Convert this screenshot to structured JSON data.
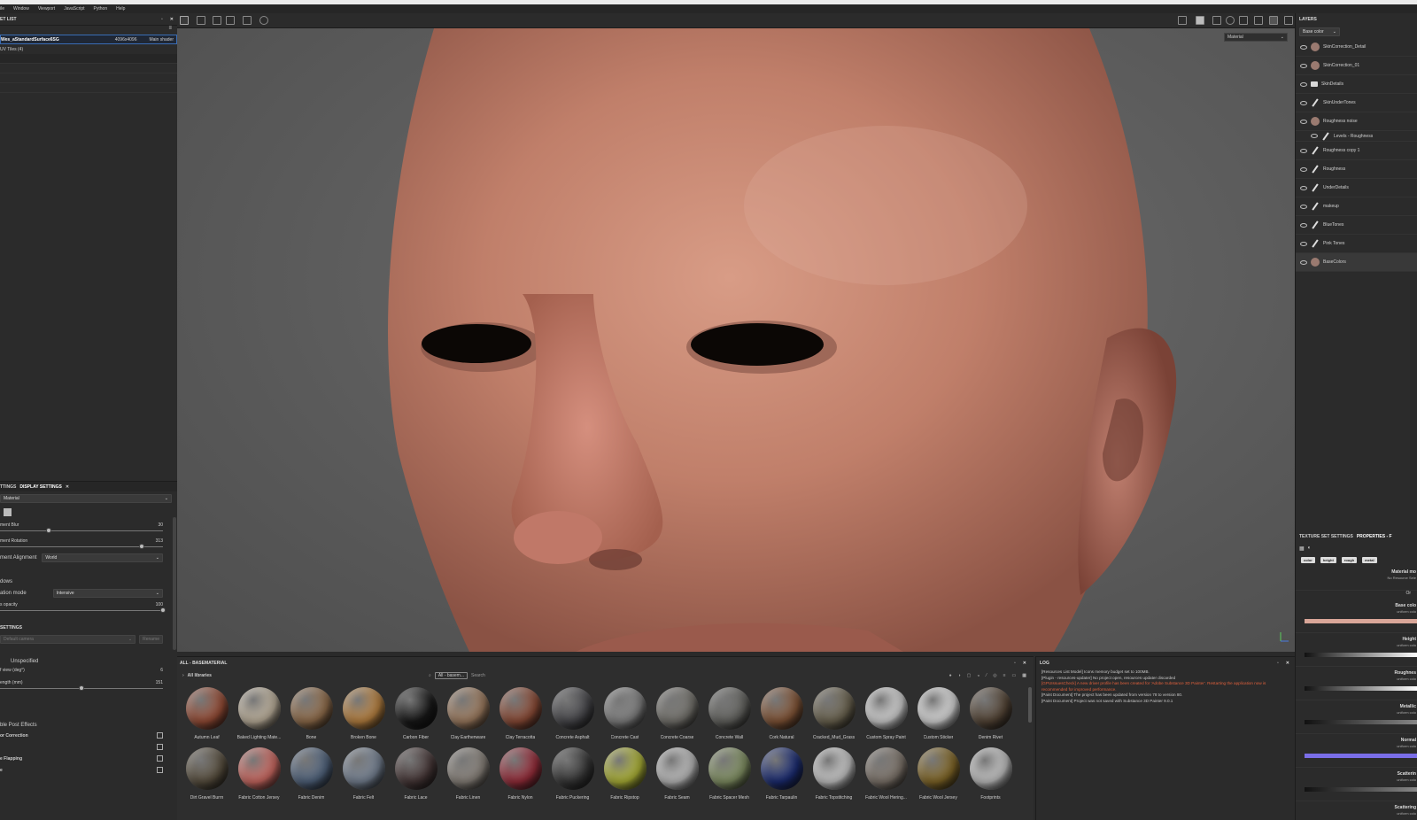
{
  "menubar": {
    "items": [
      "ile",
      "Window",
      "Viewport",
      "JavaScript",
      "Python",
      "Help"
    ]
  },
  "textureset_list": {
    "title": "ET LIST",
    "row": {
      "name": "Wes_aStandardSurface6SG",
      "size": "4096x4096",
      "shader": "Main shader"
    },
    "uv_tiles": "UV Tiles (4)"
  },
  "display_settings": {
    "tabs": [
      "TTINGS",
      "DISPLAY SETTINGS"
    ],
    "env_dropdown": "Material",
    "sliders": [
      {
        "label": "ment Blur",
        "value": "30",
        "fraction": 0.3
      },
      {
        "label": "ment Rotation",
        "value": "313",
        "fraction": 0.87
      }
    ],
    "alignment_label": "ment Alignment",
    "alignment_value": "World",
    "shadows_label": "dows",
    "mode_label": "ation mode",
    "mode_value": "Intensive",
    "opacity_label": "s opacity",
    "opacity_value": "100",
    "opacity_fraction": 1.0,
    "camera_section": "SETTINGS",
    "camera_dd": "Default camera",
    "camera_btn": "Rename",
    "unspecified": "Unspecified",
    "fov_label": "f view (deg°)",
    "fov_value": "6",
    "focal_label": "ength (mm)",
    "focal_value": "151",
    "focal_fraction": 0.5,
    "post_effects": "ble Post Effects",
    "checks": [
      "or Correction",
      "",
      "e Flapping",
      "e"
    ]
  },
  "viewport": {
    "dropdown": "Material"
  },
  "layers": {
    "title": "LAYERS",
    "channel_dropdown": "Base color",
    "items": [
      {
        "name": "SkinCorrection_Detail",
        "kind": "sphere"
      },
      {
        "name": "SkinCorrection_01",
        "kind": "sphere"
      },
      {
        "name": "SkinDetails",
        "kind": "folder"
      },
      {
        "name": "SkinUnderTones",
        "kind": "brush"
      },
      {
        "name": "Roughness noise",
        "kind": "sphere"
      },
      {
        "name": "Levels - Roughness",
        "kind": "sub"
      },
      {
        "name": "Roughness copy 1",
        "kind": "brush"
      },
      {
        "name": "Roughness",
        "kind": "brush"
      },
      {
        "name": "UnderDetails",
        "kind": "brush"
      },
      {
        "name": "makeup",
        "kind": "brush"
      },
      {
        "name": "BlueTones",
        "kind": "brush"
      },
      {
        "name": "Pink Tones",
        "kind": "brush"
      },
      {
        "name": "BaseColors",
        "kind": "sphere-sel"
      }
    ]
  },
  "texture_set_settings": {
    "tabs": [
      "TEXTURE SET SETTINGS",
      "PROPERTIES - F"
    ],
    "chips": [
      "color",
      "height",
      "rough",
      "metal"
    ],
    "material_title": "Material mo",
    "material_sub": "No Resource Sele",
    "or": "Or",
    "props": [
      {
        "title": "Base colo",
        "sub": "uniform colo"
      },
      {
        "title": "Height",
        "sub": "uniform colo"
      },
      {
        "title": "Roughnes",
        "sub": "uniform colo"
      },
      {
        "title": "Metallic",
        "sub": "uniform colo"
      },
      {
        "title": "Normal",
        "sub": "uniform colo"
      },
      {
        "title": "Scatterin",
        "sub": "uniform colo"
      },
      {
        "title": "Scattering",
        "sub": "uniform colo"
      }
    ]
  },
  "shelf": {
    "title": "ALL - BASEMATERIAL",
    "library": "All libraries",
    "filter": "All - basem...",
    "search_placeholder": "Search",
    "materials": [
      {
        "name": "Autumn Leaf",
        "color": "#a0523a"
      },
      {
        "name": "Baked Lighting Mate...",
        "color": "#c9bca6"
      },
      {
        "name": "Bone",
        "color": "#9a7450"
      },
      {
        "name": "Broken Bone",
        "color": "#c48a45"
      },
      {
        "name": "Carbon Fiber",
        "color": "#1a1a1a"
      },
      {
        "name": "Clay Earthenware",
        "color": "#a88466"
      },
      {
        "name": "Clay Terracotta",
        "color": "#94503a"
      },
      {
        "name": "Concrete Asphalt",
        "color": "#4c4c50"
      },
      {
        "name": "Concrete Cast",
        "color": "#8a8a8a"
      },
      {
        "name": "Concrete Coarse",
        "color": "#7c7a74"
      },
      {
        "name": "Concrete Wall",
        "color": "#6a6a66"
      },
      {
        "name": "Cork Natural",
        "color": "#8a5a3a"
      },
      {
        "name": "Cracked_Mud_Grass",
        "color": "#726a55"
      },
      {
        "name": "Custom Spray Paint",
        "color": "#e0e0e0"
      },
      {
        "name": "Custom Sticker",
        "color": "#e8e8e8"
      },
      {
        "name": "Denim Rivet",
        "color": "#5a4a3a"
      },
      {
        "name": "Dirt Gravel Burrn",
        "color": "#5e5443"
      },
      {
        "name": "Fabric Cotton Jersey",
        "color": "#d97068"
      },
      {
        "name": "Fabric Denim",
        "color": "#566a85"
      },
      {
        "name": "Fabric Felt",
        "color": "#7d8a9c"
      },
      {
        "name": "Fabric Lace",
        "color": "#4a3a3a"
      },
      {
        "name": "Fabric Linen",
        "color": "#918a82"
      },
      {
        "name": "Fabric Nylon",
        "color": "#a0303e"
      },
      {
        "name": "Fabric Puckering",
        "color": "#3a3a3a"
      },
      {
        "name": "Fabric Ripstop",
        "color": "#b8be3a"
      },
      {
        "name": "Fabric Seam",
        "color": "#c9c9c9"
      },
      {
        "name": "Fabric Spacer Mesh",
        "color": "#8a9a6a"
      },
      {
        "name": "Fabric Tarpaulin",
        "color": "#1d2f7a"
      },
      {
        "name": "Fabric Topstitching",
        "color": "#d5d5d5"
      },
      {
        "name": "Fabric Wool Hering...",
        "color": "#867c72"
      },
      {
        "name": "Fabric Wool Jersey",
        "color": "#8a6e2a"
      },
      {
        "name": "Footprints",
        "color": "#d0d0d0"
      }
    ]
  },
  "log": {
    "title": "LOG",
    "lines": [
      {
        "text": "[Resources List Model] Icons memory budget set to 100MB.",
        "level": "info"
      },
      {
        "text": "[Plugin - resources-updater] No project open, resources updater discarded",
        "level": "info"
      },
      {
        "text": "[GPUIssuesCheck] A new driver profile has been created for 'Adobe Substance 3D Painter'. Restarting the application now is recommended for improved performance.",
        "level": "error"
      },
      {
        "text": "[Paint Document] The project has been updated from version 78 to version 80.",
        "level": "info"
      },
      {
        "text": "[Paint Document] Project was not saved with Substance 3D Painter 9.0.1",
        "level": "info"
      }
    ]
  },
  "colors": {
    "accent": "#3a6db5",
    "selection": "#1f2735",
    "error": "#e0603c"
  }
}
